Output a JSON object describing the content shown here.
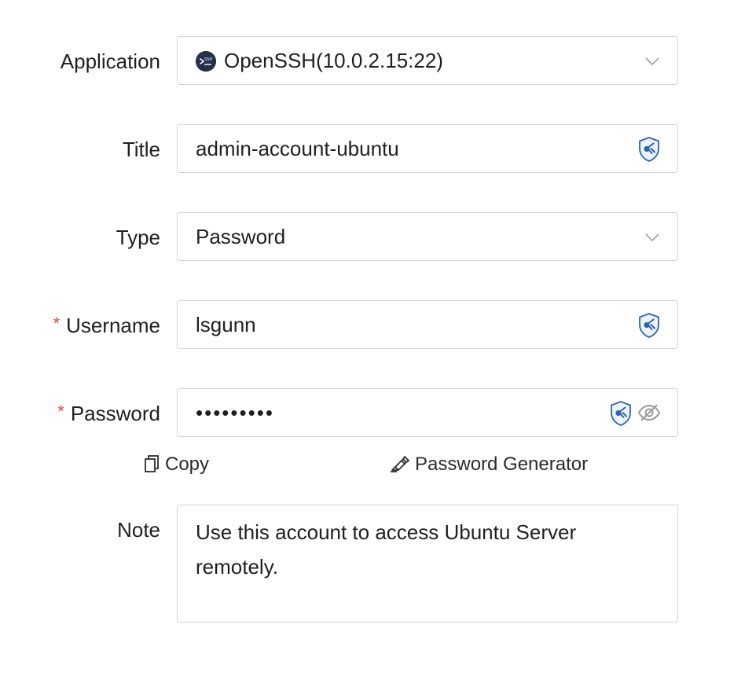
{
  "form": {
    "application": {
      "label": "Application",
      "value": "OpenSSH(10.0.2.15:22)",
      "logo_text": "SSH",
      "icon": "chevron-down-icon"
    },
    "title": {
      "label": "Title",
      "value": "admin-account-ubuntu",
      "icon": "password-manager-shield-icon"
    },
    "type": {
      "label": "Type",
      "value": "Password",
      "icon": "chevron-down-icon"
    },
    "username": {
      "required_mark": "*",
      "label": "Username",
      "value": "lsgunn",
      "icon": "password-manager-shield-icon"
    },
    "password": {
      "required_mark": "*",
      "label": "Password",
      "value": "•••••••••",
      "icons": [
        "password-manager-shield-icon",
        "eye-slash-icon"
      ]
    },
    "actions": {
      "copy_label": "Copy",
      "generator_label": "Password Generator"
    },
    "note": {
      "label": "Note",
      "value": "Use this account to access Ubuntu Server remotely."
    }
  },
  "colors": {
    "border": "#d4d4d4",
    "required": "#e5484d",
    "shield": "#2a64b0",
    "logo_bg": "#25304a",
    "icon_gray": "#9a9a9a"
  }
}
